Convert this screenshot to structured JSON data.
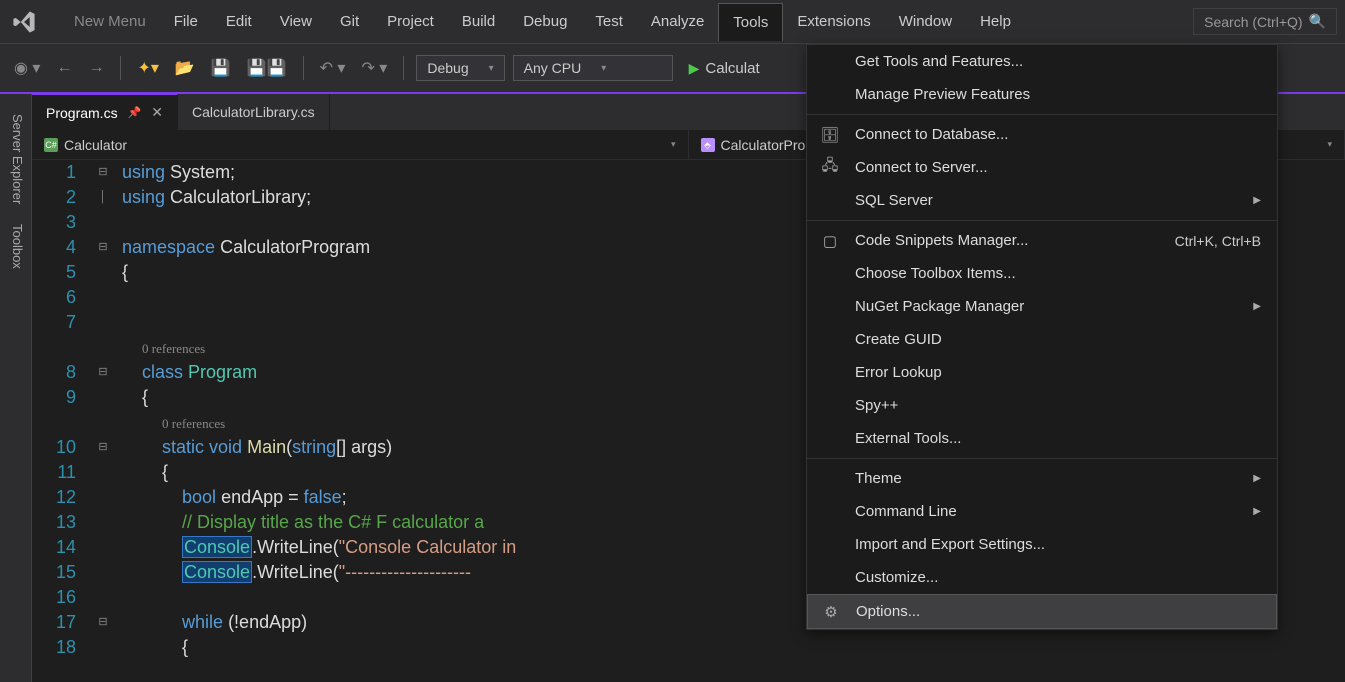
{
  "menubar": {
    "items": [
      "New Menu",
      "File",
      "Edit",
      "View",
      "Git",
      "Project",
      "Build",
      "Debug",
      "Test",
      "Analyze",
      "Tools",
      "Extensions",
      "Window",
      "Help"
    ],
    "active_index": 10,
    "search_placeholder": "Search (Ctrl+Q)"
  },
  "toolbar": {
    "config_dd": "Debug",
    "platform_dd": "Any CPU",
    "run_label": "Calculat"
  },
  "sidebar": {
    "tabs": [
      "Server Explorer",
      "Toolbox"
    ]
  },
  "tabs": [
    {
      "label": "Program.cs",
      "active": true
    },
    {
      "label": "CalculatorLibrary.cs",
      "active": false
    }
  ],
  "crumbs": {
    "left": "Calculator",
    "right": "CalculatorProgram.Program"
  },
  "code": {
    "references_label": "0 references",
    "lines": [
      "1",
      "2",
      "3",
      "4",
      "5",
      "6",
      "7",
      "8",
      "9",
      "10",
      "11",
      "12",
      "13",
      "14",
      "15",
      "16",
      "17",
      "18"
    ]
  },
  "dropdown": {
    "groups": [
      [
        {
          "label": "Get Tools and Features..."
        },
        {
          "label": "Manage Preview Features"
        }
      ],
      [
        {
          "label": "Connect to Database...",
          "icon": "db"
        },
        {
          "label": "Connect to Server...",
          "icon": "server"
        },
        {
          "label": "SQL Server",
          "submenu": true
        }
      ],
      [
        {
          "label": "Code Snippets Manager...",
          "icon": "snippet",
          "shortcut": "Ctrl+K, Ctrl+B"
        },
        {
          "label": "Choose Toolbox Items..."
        },
        {
          "label": "NuGet Package Manager",
          "submenu": true
        },
        {
          "label": "Create GUID"
        },
        {
          "label": "Error Lookup"
        },
        {
          "label": "Spy++"
        },
        {
          "label": "External Tools..."
        }
      ],
      [
        {
          "label": "Theme",
          "submenu": true
        },
        {
          "label": "Command Line",
          "submenu": true
        },
        {
          "label": "Import and Export Settings..."
        },
        {
          "label": "Customize..."
        },
        {
          "label": "Options...",
          "icon": "gear",
          "selected": true
        }
      ]
    ]
  }
}
